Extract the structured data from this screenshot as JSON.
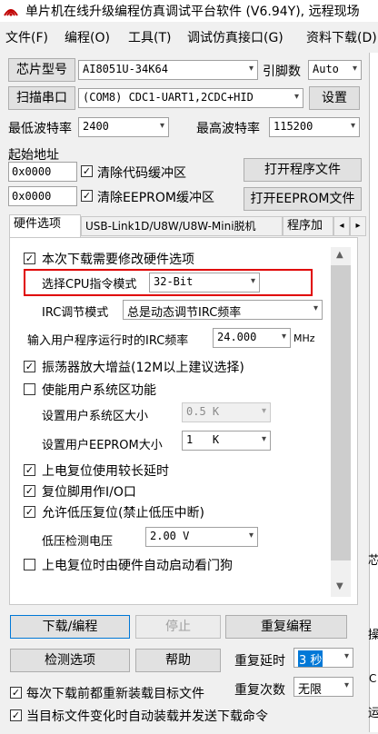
{
  "title": "单片机在线升级编程仿真调试平台软件 (V6.94Y), 远程现场",
  "menu": [
    "文件(F)",
    "编程(O)",
    "工具(T)",
    "调试仿真接口(G)",
    "资料下载(D)"
  ],
  "chip": {
    "button": "芯片型号",
    "value": "AI8051U-34K64",
    "pins_label": "引脚数",
    "pins_value": "Auto"
  },
  "port": {
    "button": "扫描串口",
    "value": "(COM8) CDC1-UART1,2CDC+HID",
    "settings": "设置"
  },
  "baud": {
    "min_label": "最低波特率",
    "min_value": "2400",
    "max_label": "最高波特率",
    "max_value": "115200"
  },
  "start_addr": {
    "label": "起始地址",
    "code_addr": "0x0000",
    "clear_code": "清除代码缓冲区",
    "open_program": "打开程序文件",
    "eeprom_addr": "0x0000",
    "clear_eeprom": "清除EEPROM缓冲区",
    "open_eeprom": "打开EEPROM文件"
  },
  "tabs": [
    "硬件选项",
    "USB-Link1D/U8W/U8W-Mini脱机",
    "程序加"
  ],
  "tab_nav": [
    "◂",
    "▸"
  ],
  "hw": {
    "modify": "本次下载需要修改硬件选项",
    "cpu_mode_label": "选择CPU指令模式",
    "cpu_mode_value": "32-Bit",
    "irc_label": "IRC调节模式",
    "irc_value": "总是动态调节IRC频率",
    "freq_label": "输入用户程序运行时的IRC频率",
    "freq_value": "24.000",
    "freq_unit": "MHz",
    "osc_gain": "振荡器放大增益(12M以上建议选择)",
    "sys_area": "使能用户系统区功能",
    "sys_size_label": "设置用户系统区大小",
    "sys_size_value": "0.5 K",
    "eeprom_size_label": "设置用户EEPROM大小",
    "eeprom_size_value": "1   K",
    "long_delay": "上电复位使用较长延时",
    "reset_io": "复位脚用作I/O口",
    "lvr": "允许低压复位(禁止低压中断)",
    "lv_label": "低压检测电压",
    "lv_value": "2.00 V",
    "watchdog": "上电复位时由硬件自动启动看门狗"
  },
  "actions": {
    "download": "下载/编程",
    "stop": "停止",
    "reprogram": "重复编程",
    "check": "检测选项",
    "help": "帮助",
    "delay_label": "重复延时",
    "delay_value": "3 秒",
    "count_label": "重复次数",
    "count_value": "无限",
    "reload": "每次下载前都重新装载目标文件",
    "auto_send": "当目标文件变化时自动装载并发送下载命令"
  },
  "right_edge": [
    "芯",
    "操",
    "C",
    "运"
  ]
}
